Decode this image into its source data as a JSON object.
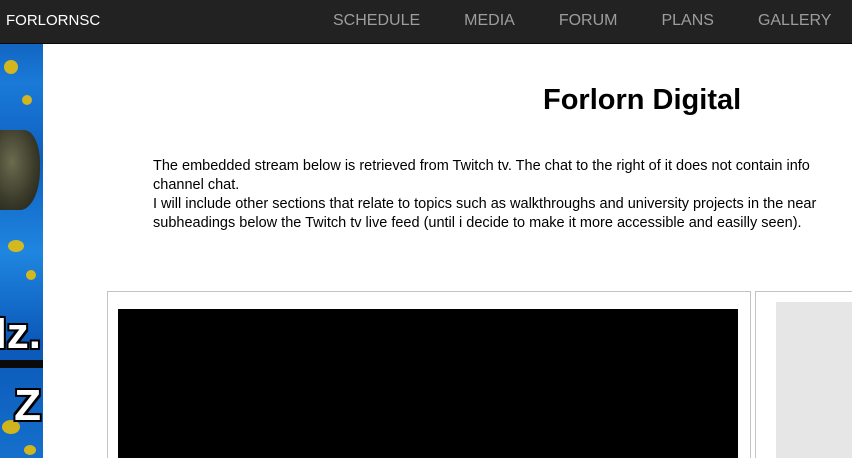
{
  "navbar": {
    "brand": "FORLORNSC",
    "items": [
      {
        "label": "SCHEDULE"
      },
      {
        "label": "MEDIA"
      },
      {
        "label": "FORUM"
      },
      {
        "label": "PLANS"
      },
      {
        "label": "GALLERY"
      }
    ]
  },
  "sidebar_image": {
    "text_top": "Iz.",
    "text_bottom": "Z"
  },
  "main": {
    "title": "Forlorn Digital",
    "intro_lines": [
      "The embedded stream below is retrieved from Twitch tv. The chat to the right of it does not contain info",
      "channel chat.",
      "I will include other sections that relate to topics such as walkthroughs and university projects in the near",
      "subheadings below the Twitch tv live feed (until i decide to make it more accessible and easilly seen)."
    ]
  },
  "colors": {
    "navbar_bg": "#222222",
    "nav_text": "#9d9d9d",
    "brand_text": "#ffffff",
    "video_bg": "#000000",
    "chat_bg": "#e6e6e6"
  }
}
